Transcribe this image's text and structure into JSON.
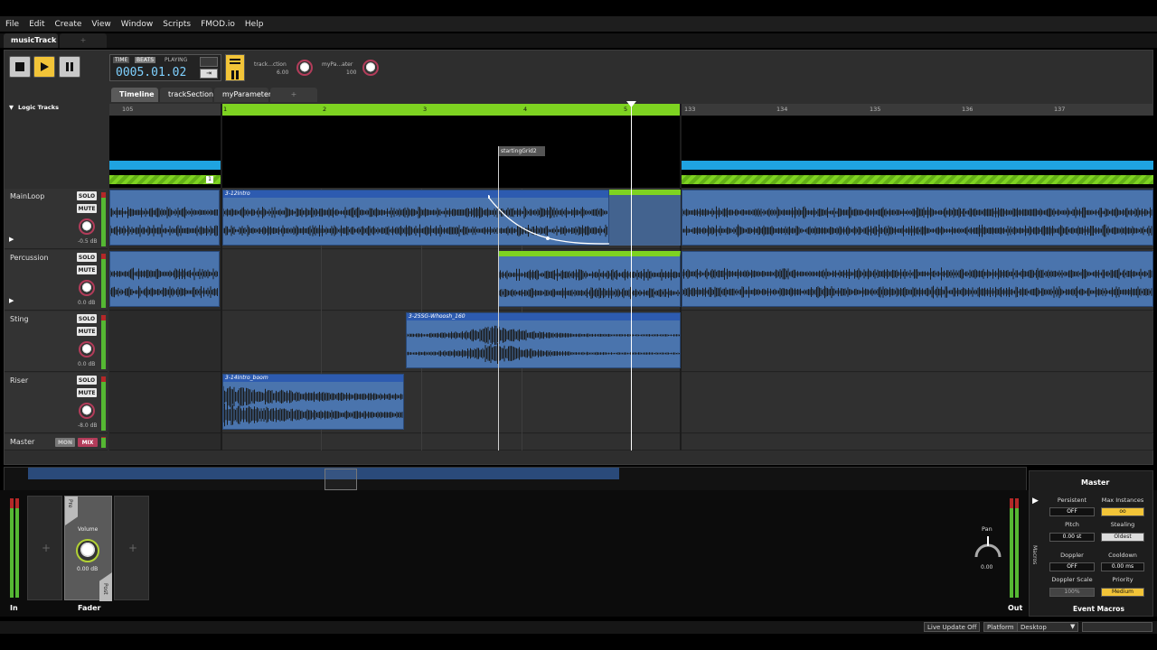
{
  "menu": [
    "File",
    "Edit",
    "Create",
    "View",
    "Window",
    "Scripts",
    "FMOD.io",
    "Help"
  ],
  "doc_tab": {
    "label": "musicTrack ▶",
    "add": "+"
  },
  "transport": {
    "time_mode": "TIME",
    "beats_mode": "BEATS",
    "state": "PLAYING",
    "position": "0005.01.02",
    "param1": {
      "name": "track...ction",
      "value": "6.00"
    },
    "param2": {
      "name": "myPa...ater",
      "value": "100"
    }
  },
  "tabs": [
    {
      "label": "Timeline"
    },
    {
      "label": "trackSection"
    },
    {
      "label": "myParameter"
    }
  ],
  "tab_add": "+",
  "ruler": {
    "left": [
      "105"
    ],
    "mid": [
      "1",
      "2",
      "3",
      "4",
      "5"
    ],
    "right": [
      "133",
      "134",
      "135",
      "136",
      "137"
    ]
  },
  "logic_tracks_label": "Logic Tracks",
  "loop_count": "1",
  "marker": "startingGrid2",
  "tracks": [
    {
      "name": "MainLoop",
      "solo": "SOLO",
      "mute": "MUTE",
      "db": "-0.5 dB"
    },
    {
      "name": "Percussion",
      "solo": "SOLO",
      "mute": "MUTE",
      "db": "0.0 dB"
    },
    {
      "name": "Sting",
      "solo": "SOLO",
      "mute": "MUTE",
      "db": "0.0 dB"
    },
    {
      "name": "Riser",
      "solo": "SOLO",
      "mute": "MUTE",
      "db": "-8.0 dB"
    }
  ],
  "master_track": {
    "name": "Master",
    "mon": "MON",
    "mix": "MIX"
  },
  "regions": {
    "main": "3-12Intro",
    "sting": "3-25SG-Whoosh_160",
    "riser": "3-14Intro_boom"
  },
  "deck": {
    "in": "In",
    "fader": "Fader",
    "pre": "Pre",
    "post": "Post",
    "volume": "Volume",
    "volume_db": "0.00 dB",
    "add": "+",
    "pan": "Pan",
    "pan_value": "0.00",
    "out": "Out"
  },
  "master_panel": {
    "title": "Master",
    "macros": "Macros",
    "footer": "Event Macros",
    "persistent": {
      "label": "Persistent",
      "value": "OFF"
    },
    "max_instances": {
      "label": "Max Instances",
      "value": "oo"
    },
    "pitch": {
      "label": "Pitch",
      "value": "0.00 st"
    },
    "stealing": {
      "label": "Stealing",
      "value": "Oldest"
    },
    "doppler": {
      "label": "Doppler",
      "value": "OFF"
    },
    "cooldown": {
      "label": "Cooldown",
      "value": "0.00 ms"
    },
    "doppler_scale": {
      "label": "Doppler Scale",
      "value": "100%"
    },
    "priority": {
      "label": "Priority",
      "value": "Medium"
    }
  },
  "status": {
    "live_update": "Live Update Off",
    "platform_label": "Platform",
    "platform": "Desktop"
  },
  "colors": {
    "accent_green": "#7ed321",
    "region_blue": "#4a74ad",
    "logic_blue": "#1fa3e0",
    "play_yellow": "#f2c438"
  }
}
